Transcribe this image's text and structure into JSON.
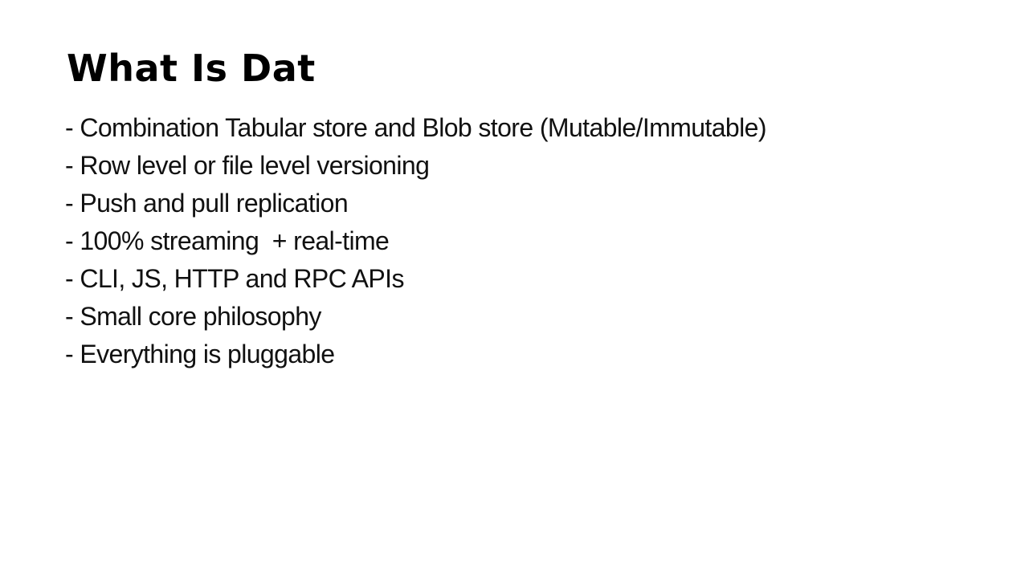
{
  "slide": {
    "title": "What Is Dat",
    "bullets": [
      "- Combination Tabular store and Blob store (Mutable/Immutable)",
      "- Row level or file level versioning",
      "- Push and pull replication",
      "- 100% streaming  + real-time",
      "- CLI, JS, HTTP and RPC APIs",
      "- Small core philosophy",
      "- Everything is pluggable"
    ]
  }
}
